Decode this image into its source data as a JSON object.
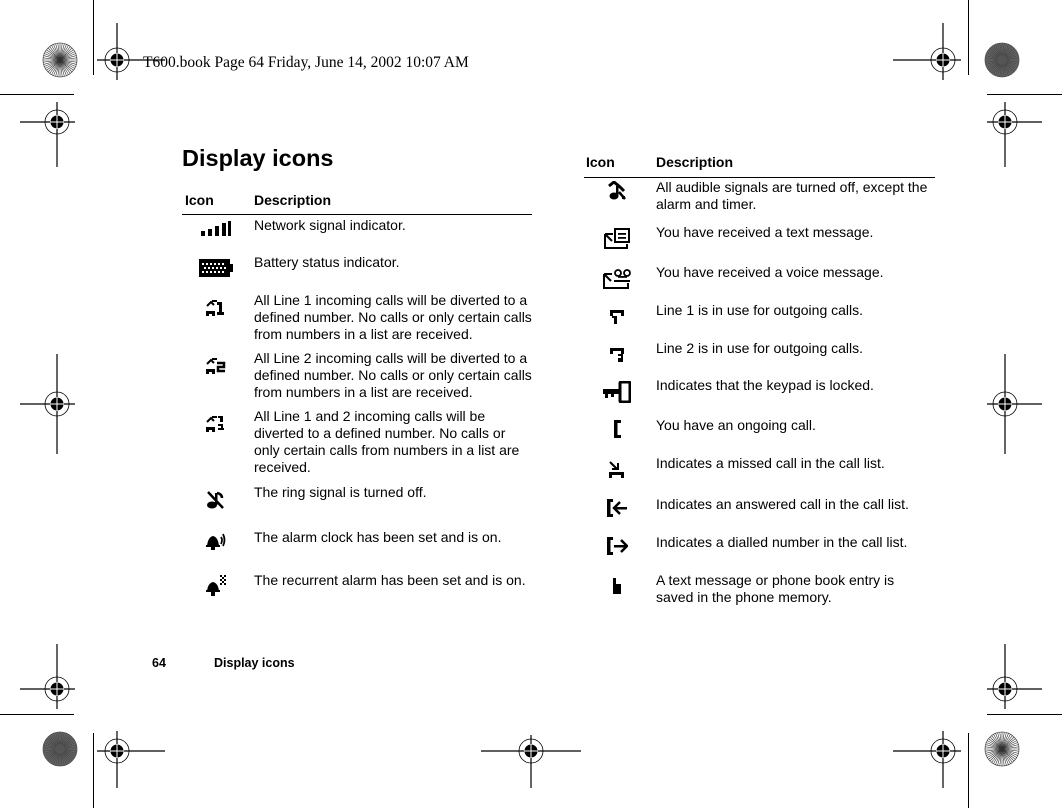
{
  "slug": "T600.book  Page 64  Friday, June 14, 2002  10:07 AM",
  "page_title": "Display icons",
  "columns": {
    "icon": "Icon",
    "description": "Description"
  },
  "left_table": [
    {
      "icon": "network-signal-icon",
      "description": "Network signal indicator."
    },
    {
      "icon": "battery-status-icon",
      "description": "Battery status indicator."
    },
    {
      "icon": "divert-line1-icon",
      "description": "All Line 1 incoming calls will be diverted to a defined number. No calls or only certain calls from numbers in a list are received."
    },
    {
      "icon": "divert-line2-icon",
      "description": "All Line 2 incoming calls will be diverted to a defined number. No calls or only certain calls from numbers in a list are received."
    },
    {
      "icon": "divert-line1-2-icon",
      "description": "All Line 1 and 2 incoming calls will be diverted to a defined number. No calls or only certain calls from numbers in a list are received."
    },
    {
      "icon": "ring-off-icon",
      "description": "The ring signal is turned off."
    },
    {
      "icon": "alarm-clock-icon",
      "description": "The alarm clock has been set and is on."
    },
    {
      "icon": "recurrent-alarm-icon",
      "description": "The recurrent alarm has been set and is on."
    }
  ],
  "right_table": [
    {
      "icon": "silent-mode-icon",
      "description": "All audible signals are turned off, except the alarm and timer."
    },
    {
      "icon": "text-message-icon",
      "description": "You have received a text message."
    },
    {
      "icon": "voice-message-icon",
      "description": "You have received a voice message."
    },
    {
      "icon": "line1-outgoing-icon",
      "description": "Line 1 is in use for outgoing calls."
    },
    {
      "icon": "line2-outgoing-icon",
      "description": "Line 2 is in use for outgoing calls."
    },
    {
      "icon": "keypad-lock-icon",
      "description": "Indicates that the keypad is locked."
    },
    {
      "icon": "ongoing-call-icon",
      "description": "You have an ongoing call."
    },
    {
      "icon": "missed-call-icon",
      "description": "Indicates a missed call in the call list."
    },
    {
      "icon": "answered-call-icon",
      "description": "Indicates an answered call in the call list."
    },
    {
      "icon": "dialled-number-icon",
      "description": "Indicates a dialled number in the call list."
    },
    {
      "icon": "phone-memory-icon",
      "description": "A text message or phone book entry is saved in the phone memory."
    }
  ],
  "footer": {
    "page_number": "64",
    "section": "Display icons"
  }
}
